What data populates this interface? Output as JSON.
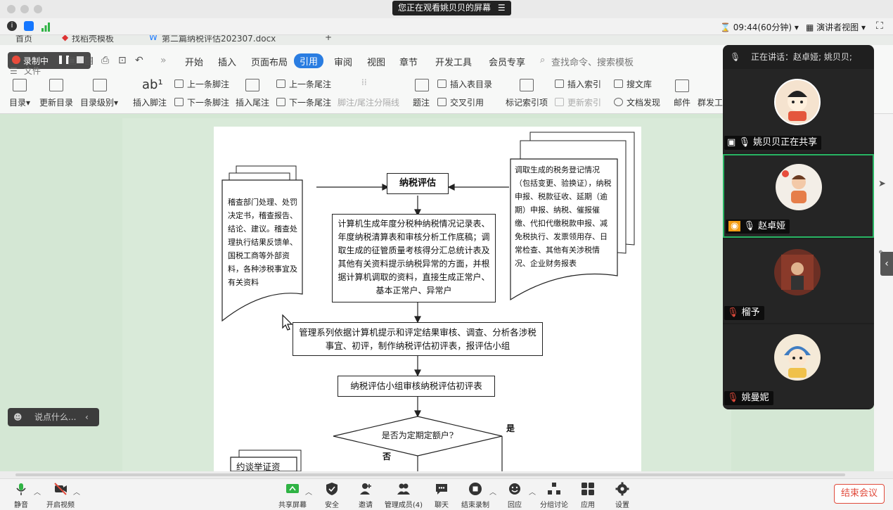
{
  "window": {
    "banner": "您正在观看姚贝贝的屏幕"
  },
  "meeting_status": {
    "timer": "09:44(60分钟)",
    "view_mode": "演讲者视图"
  },
  "wps": {
    "doc_tabs": [
      "首页",
      "找稻壳模板",
      "第二篇纳税评估202307.docx"
    ],
    "recording": {
      "label": "录制中"
    },
    "file_menu": "文件",
    "menu": [
      "开始",
      "插入",
      "页面布局",
      "引用",
      "审阅",
      "视图",
      "章节",
      "开发工具",
      "会员专享"
    ],
    "active_menu": "引用",
    "search_placeholder": "查找命令、搜索模板",
    "ribbon": {
      "toc": "目录",
      "update_toc": "更新目录",
      "toc_level": "目录级别",
      "insert_footnote": "插入脚注",
      "prev_footnote": "上一条脚注",
      "next_footnote": "下一条脚注",
      "insert_endnote": "插入尾注",
      "prev_endnote": "上一条尾注",
      "next_endnote": "下一条尾注",
      "footnote_separator": "脚注/尾注分隔线",
      "caption": "题注",
      "insert_table_of_figures": "插入表目录",
      "cross_reference": "交叉引用",
      "mark_index": "标记索引项",
      "insert_index": "插入索引",
      "update_index": "更新索引",
      "search_library": "搜文库",
      "doc_discovery": "文档发现",
      "mail": "邮件",
      "mail_merge": "群发工"
    }
  },
  "flowchart": {
    "title_node": "纳税评估",
    "left_doc": "稽查部门处理、处罚决定书，稽查报告、结论、建议。稽查处理执行结果反馈单、国税工商等外部资料，各种涉税事宜及有关资料",
    "right_doc": "调取生成的税务登记情况（包括变更、验换证），纳税申报、税款征收、延期（逾期）申报、纳税、催报催缴、代扣代缴税款申报、减免税执行、发票领用存、日常检查、其他有关涉税情况、企业财务报表",
    "center_box": "计算机生成年度分税种纳税情况记录表、年度纳税清算表和审核分析工作底稿；调取生成的征管质量考核得分汇总统计表及其他有关资料提示纳税异常的方面，并根据计算机调取的资料，直接生成正常户、基本正常户、异常户",
    "review_box": "管理系列依据计算机提示和评定结果审核、调查、分析各涉税事宜、初评，制作纳税评估初评表，报评估小组",
    "team_box": "纳税评估小组审核纳税评估初评表",
    "decision": "是否为定期定额户?",
    "yes_label": "是",
    "no_label": "否",
    "bottom_doc": "约谈举证资"
  },
  "participants": {
    "speaking": "正在讲话：赵卓娅; 姚贝贝;",
    "tiles": [
      {
        "name": "姚贝贝正在共享",
        "mic": "on",
        "sharing": true
      },
      {
        "name": "赵卓娅",
        "mic": "on",
        "active": true
      },
      {
        "name": "榴予",
        "mic": "muted"
      },
      {
        "name": "姚曼妮",
        "mic": "muted"
      }
    ]
  },
  "chat": {
    "placeholder": "说点什么..."
  },
  "toolbar": {
    "mute": "静音",
    "start_video": "开启视频",
    "share_screen": "共享屏幕",
    "security": "安全",
    "invite": "邀请",
    "manage_members": "管理成员(4)",
    "chat": "聊天",
    "end_recording": "结束录制",
    "reactions": "回应",
    "breakout": "分组讨论",
    "apps": "应用",
    "settings": "设置",
    "end_meeting": "结束会议"
  },
  "colors": {
    "accent": "#2a7de1",
    "doc_background": "#d4e7d4",
    "end_meeting": "#e04a3b",
    "active_speaker": "#28b463"
  }
}
